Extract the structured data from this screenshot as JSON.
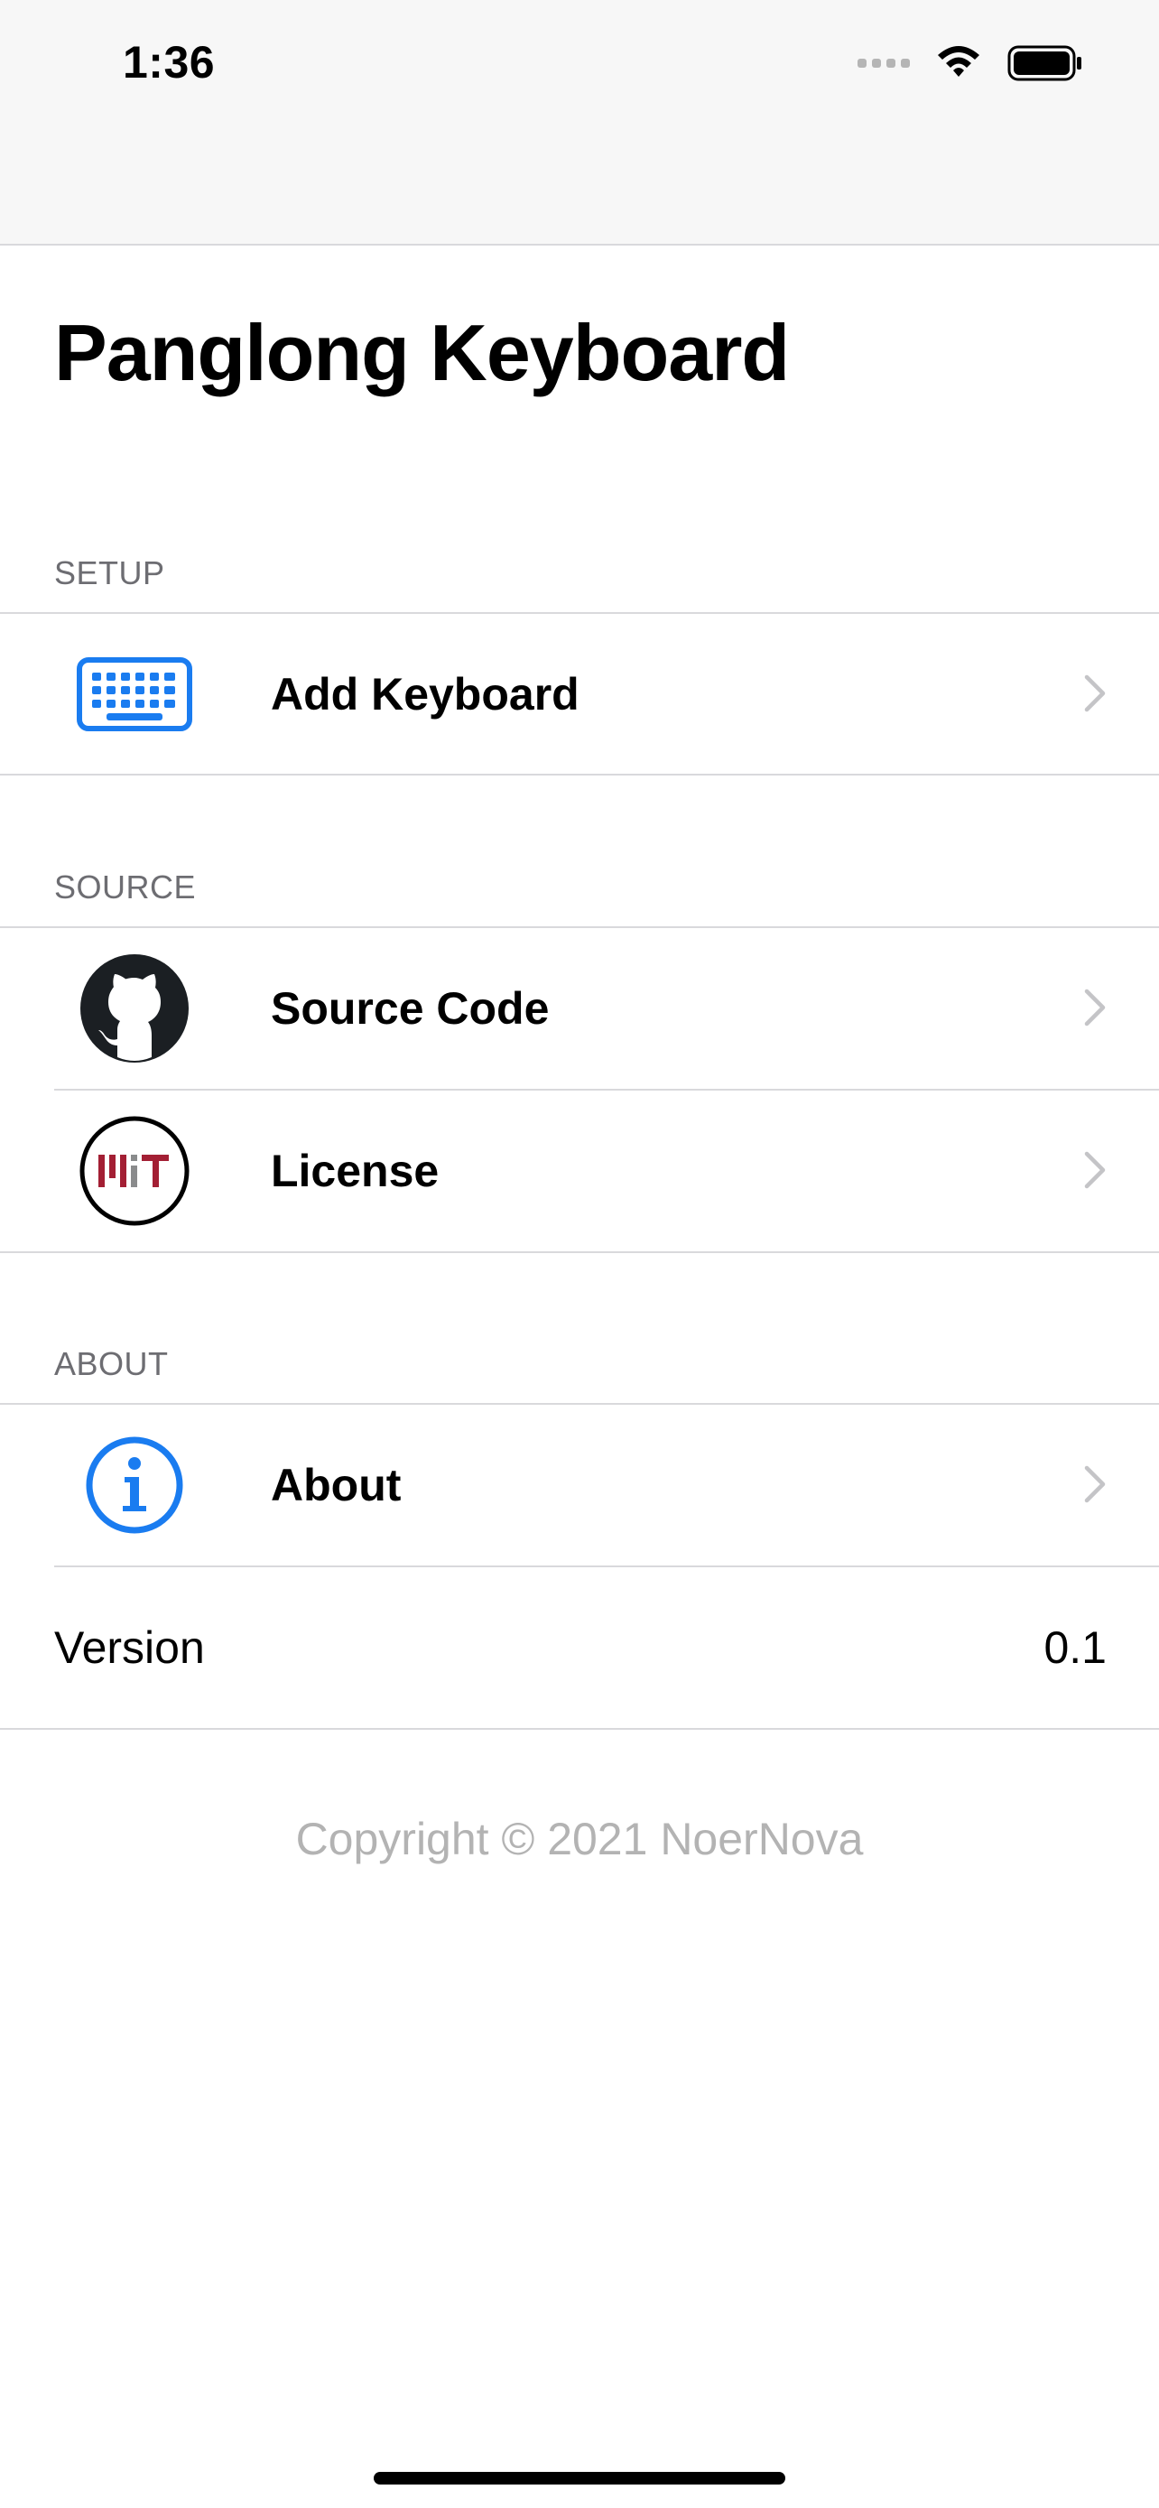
{
  "status_bar": {
    "time": "1:36",
    "icons": [
      "signal-icon",
      "wifi-icon",
      "battery-icon"
    ]
  },
  "page": {
    "title": "Panglong Keyboard"
  },
  "sections": {
    "setup": {
      "header": "SETUP",
      "items": [
        {
          "label": "Add Keyboard",
          "icon": "keyboard-icon"
        }
      ]
    },
    "source": {
      "header": "SOURCE",
      "items": [
        {
          "label": "Source Code",
          "icon": "github-icon"
        },
        {
          "label": "License",
          "icon": "mit-license-icon"
        }
      ]
    },
    "about": {
      "header": "ABOUT",
      "items": [
        {
          "label": "About",
          "icon": "info-icon"
        }
      ],
      "version": {
        "label": "Version",
        "value": "0.1"
      }
    }
  },
  "footer": {
    "copyright": "Copyright © 2021 NoerNova"
  },
  "colors": {
    "accent": "#1a7cf0",
    "secondary_text": "#6d6d72",
    "separator": "#d9d9dc",
    "footer_text": "#b3b3b3",
    "mit_red": "#a31f34",
    "mit_gray": "#8a8b8c"
  }
}
